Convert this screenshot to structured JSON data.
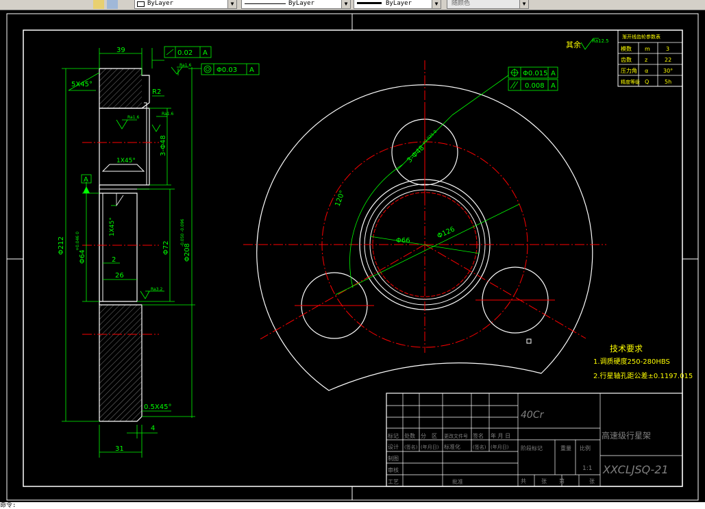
{
  "toolbar": {
    "layer_linetype_label": "ByLayer",
    "lineweight_label": "ByLayer",
    "plotstyle_label": "ByLayer",
    "color_label": "随颜色"
  },
  "section_view": {
    "dim_width_top": "39",
    "dim_width_bottom": "31",
    "dim_gap": "4",
    "dim_26": "26",
    "dim_2": "2",
    "dim_outer_dia": "Φ212",
    "dim_bore": "Φ64",
    "dim_bore_tol": "+0.046 0",
    "dim_72": "Φ72",
    "dim_208": "Φ208",
    "dim_208_tol": "-0.050 -0.096",
    "dim_holes": "3-Φ48",
    "chamfer_top": "5X45°",
    "chamfer_mid": "1X45°",
    "chamfer_inner": "1X45°",
    "chamfer_bottom": "0.5X45°",
    "radius": "R2",
    "rough_ra16": "Ra1.6",
    "rough_ra32": "Ra3.2",
    "datum": "A",
    "gdt_flatness_value": "0.02",
    "gdt_flatness_datum": "A",
    "gdt_coax_value": "Φ0.03",
    "gdt_coax_datum": "A"
  },
  "front_view": {
    "dim_66": "Φ66",
    "dim_126": "Φ126",
    "dim_holes": "3-Φ48",
    "holes_tol": "+0.025 0",
    "angle": "120°",
    "gdt_pos_value": "Φ0.015",
    "gdt_pos_datum": "A",
    "gdt_par_value": "0.008",
    "gdt_par_datum": "A"
  },
  "notes": {
    "rest_roughness": "其余",
    "rest_ra": "Ra12.5",
    "tech_title": "技术要求",
    "tech_1": "1.调质硬度250-280HBS",
    "tech_2": "2.行星轴孔距公差±0.1197.015"
  },
  "gear_table": {
    "title": "渐开线齿轮参数表",
    "rows": [
      {
        "name": "模数",
        "sym": "m",
        "val": "3"
      },
      {
        "name": "齿数",
        "sym": "z",
        "val": "22"
      },
      {
        "name": "压力角",
        "sym": "α",
        "val": "30°"
      },
      {
        "name": "精度等级",
        "sym": "Q",
        "val": "5h"
      }
    ]
  },
  "title_block": {
    "material": "40Cr",
    "part_name": "高速级行星架",
    "drawing_no": "XXCLJSQ-21",
    "scale": "1:1",
    "h_mark": "标记",
    "h_count": "处数",
    "h_div": "分",
    "h_zone": "区",
    "h_doc": "更改文件号",
    "h_sign": "签名",
    "h_date": "年 月 日",
    "r_design": "设计",
    "r_sign": "(签名)",
    "r_date": "(年月日)",
    "r_std": "标准化",
    "r_draw": "制图",
    "r_check": "审核",
    "r_craft": "工艺",
    "r_approve": "批准",
    "stage_mark": "阶段标记",
    "weight": "重量",
    "ratio": "比例",
    "total": "共",
    "sheet": "张",
    "no": "第",
    "sheet2": "张"
  },
  "colors": {
    "dim": "#00ff00",
    "outline": "#ffffff",
    "center": "#ff0000",
    "text_yellow": "#ffff00",
    "text_green": "#00ff00",
    "hatch": "#c0c0c0"
  },
  "cmdline": {
    "prompt": "命令:"
  }
}
